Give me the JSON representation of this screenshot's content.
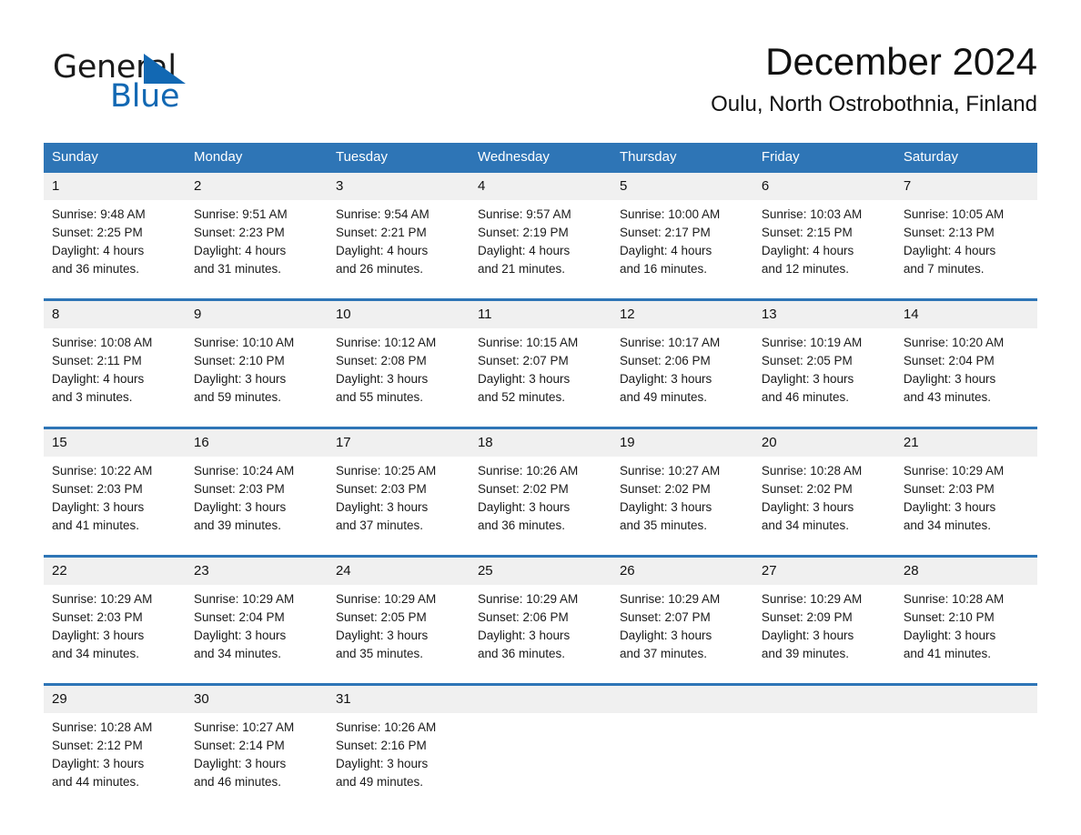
{
  "brand": {
    "name_part1": "General",
    "name_part2": "Blue",
    "triangle_icon": "triangle-icon",
    "accent_color": "#1268b3"
  },
  "header": {
    "title": "December 2024",
    "subtitle": "Oulu, North Ostrobothnia, Finland"
  },
  "theme": {
    "header_blue": "#2e75b6",
    "daynum_gray": "#f0f0f0",
    "text_color": "#1a1a1a"
  },
  "weekday_headers": [
    "Sunday",
    "Monday",
    "Tuesday",
    "Wednesday",
    "Thursday",
    "Friday",
    "Saturday"
  ],
  "weeks": [
    [
      {
        "day": "1",
        "sunrise": "Sunrise: 9:48 AM",
        "sunset": "Sunset: 2:25 PM",
        "daylight1": "Daylight: 4 hours",
        "daylight2": "and 36 minutes."
      },
      {
        "day": "2",
        "sunrise": "Sunrise: 9:51 AM",
        "sunset": "Sunset: 2:23 PM",
        "daylight1": "Daylight: 4 hours",
        "daylight2": "and 31 minutes."
      },
      {
        "day": "3",
        "sunrise": "Sunrise: 9:54 AM",
        "sunset": "Sunset: 2:21 PM",
        "daylight1": "Daylight: 4 hours",
        "daylight2": "and 26 minutes."
      },
      {
        "day": "4",
        "sunrise": "Sunrise: 9:57 AM",
        "sunset": "Sunset: 2:19 PM",
        "daylight1": "Daylight: 4 hours",
        "daylight2": "and 21 minutes."
      },
      {
        "day": "5",
        "sunrise": "Sunrise: 10:00 AM",
        "sunset": "Sunset: 2:17 PM",
        "daylight1": "Daylight: 4 hours",
        "daylight2": "and 16 minutes."
      },
      {
        "day": "6",
        "sunrise": "Sunrise: 10:03 AM",
        "sunset": "Sunset: 2:15 PM",
        "daylight1": "Daylight: 4 hours",
        "daylight2": "and 12 minutes."
      },
      {
        "day": "7",
        "sunrise": "Sunrise: 10:05 AM",
        "sunset": "Sunset: 2:13 PM",
        "daylight1": "Daylight: 4 hours",
        "daylight2": "and 7 minutes."
      }
    ],
    [
      {
        "day": "8",
        "sunrise": "Sunrise: 10:08 AM",
        "sunset": "Sunset: 2:11 PM",
        "daylight1": "Daylight: 4 hours",
        "daylight2": "and 3 minutes."
      },
      {
        "day": "9",
        "sunrise": "Sunrise: 10:10 AM",
        "sunset": "Sunset: 2:10 PM",
        "daylight1": "Daylight: 3 hours",
        "daylight2": "and 59 minutes."
      },
      {
        "day": "10",
        "sunrise": "Sunrise: 10:12 AM",
        "sunset": "Sunset: 2:08 PM",
        "daylight1": "Daylight: 3 hours",
        "daylight2": "and 55 minutes."
      },
      {
        "day": "11",
        "sunrise": "Sunrise: 10:15 AM",
        "sunset": "Sunset: 2:07 PM",
        "daylight1": "Daylight: 3 hours",
        "daylight2": "and 52 minutes."
      },
      {
        "day": "12",
        "sunrise": "Sunrise: 10:17 AM",
        "sunset": "Sunset: 2:06 PM",
        "daylight1": "Daylight: 3 hours",
        "daylight2": "and 49 minutes."
      },
      {
        "day": "13",
        "sunrise": "Sunrise: 10:19 AM",
        "sunset": "Sunset: 2:05 PM",
        "daylight1": "Daylight: 3 hours",
        "daylight2": "and 46 minutes."
      },
      {
        "day": "14",
        "sunrise": "Sunrise: 10:20 AM",
        "sunset": "Sunset: 2:04 PM",
        "daylight1": "Daylight: 3 hours",
        "daylight2": "and 43 minutes."
      }
    ],
    [
      {
        "day": "15",
        "sunrise": "Sunrise: 10:22 AM",
        "sunset": "Sunset: 2:03 PM",
        "daylight1": "Daylight: 3 hours",
        "daylight2": "and 41 minutes."
      },
      {
        "day": "16",
        "sunrise": "Sunrise: 10:24 AM",
        "sunset": "Sunset: 2:03 PM",
        "daylight1": "Daylight: 3 hours",
        "daylight2": "and 39 minutes."
      },
      {
        "day": "17",
        "sunrise": "Sunrise: 10:25 AM",
        "sunset": "Sunset: 2:03 PM",
        "daylight1": "Daylight: 3 hours",
        "daylight2": "and 37 minutes."
      },
      {
        "day": "18",
        "sunrise": "Sunrise: 10:26 AM",
        "sunset": "Sunset: 2:02 PM",
        "daylight1": "Daylight: 3 hours",
        "daylight2": "and 36 minutes."
      },
      {
        "day": "19",
        "sunrise": "Sunrise: 10:27 AM",
        "sunset": "Sunset: 2:02 PM",
        "daylight1": "Daylight: 3 hours",
        "daylight2": "and 35 minutes."
      },
      {
        "day": "20",
        "sunrise": "Sunrise: 10:28 AM",
        "sunset": "Sunset: 2:02 PM",
        "daylight1": "Daylight: 3 hours",
        "daylight2": "and 34 minutes."
      },
      {
        "day": "21",
        "sunrise": "Sunrise: 10:29 AM",
        "sunset": "Sunset: 2:03 PM",
        "daylight1": "Daylight: 3 hours",
        "daylight2": "and 34 minutes."
      }
    ],
    [
      {
        "day": "22",
        "sunrise": "Sunrise: 10:29 AM",
        "sunset": "Sunset: 2:03 PM",
        "daylight1": "Daylight: 3 hours",
        "daylight2": "and 34 minutes."
      },
      {
        "day": "23",
        "sunrise": "Sunrise: 10:29 AM",
        "sunset": "Sunset: 2:04 PM",
        "daylight1": "Daylight: 3 hours",
        "daylight2": "and 34 minutes."
      },
      {
        "day": "24",
        "sunrise": "Sunrise: 10:29 AM",
        "sunset": "Sunset: 2:05 PM",
        "daylight1": "Daylight: 3 hours",
        "daylight2": "and 35 minutes."
      },
      {
        "day": "25",
        "sunrise": "Sunrise: 10:29 AM",
        "sunset": "Sunset: 2:06 PM",
        "daylight1": "Daylight: 3 hours",
        "daylight2": "and 36 minutes."
      },
      {
        "day": "26",
        "sunrise": "Sunrise: 10:29 AM",
        "sunset": "Sunset: 2:07 PM",
        "daylight1": "Daylight: 3 hours",
        "daylight2": "and 37 minutes."
      },
      {
        "day": "27",
        "sunrise": "Sunrise: 10:29 AM",
        "sunset": "Sunset: 2:09 PM",
        "daylight1": "Daylight: 3 hours",
        "daylight2": "and 39 minutes."
      },
      {
        "day": "28",
        "sunrise": "Sunrise: 10:28 AM",
        "sunset": "Sunset: 2:10 PM",
        "daylight1": "Daylight: 3 hours",
        "daylight2": "and 41 minutes."
      }
    ],
    [
      {
        "day": "29",
        "sunrise": "Sunrise: 10:28 AM",
        "sunset": "Sunset: 2:12 PM",
        "daylight1": "Daylight: 3 hours",
        "daylight2": "and 44 minutes."
      },
      {
        "day": "30",
        "sunrise": "Sunrise: 10:27 AM",
        "sunset": "Sunset: 2:14 PM",
        "daylight1": "Daylight: 3 hours",
        "daylight2": "and 46 minutes."
      },
      {
        "day": "31",
        "sunrise": "Sunrise: 10:26 AM",
        "sunset": "Sunset: 2:16 PM",
        "daylight1": "Daylight: 3 hours",
        "daylight2": "and 49 minutes."
      },
      {
        "day": "",
        "sunrise": "",
        "sunset": "",
        "daylight1": "",
        "daylight2": ""
      },
      {
        "day": "",
        "sunrise": "",
        "sunset": "",
        "daylight1": "",
        "daylight2": ""
      },
      {
        "day": "",
        "sunrise": "",
        "sunset": "",
        "daylight1": "",
        "daylight2": ""
      },
      {
        "day": "",
        "sunrise": "",
        "sunset": "",
        "daylight1": "",
        "daylight2": ""
      }
    ]
  ]
}
